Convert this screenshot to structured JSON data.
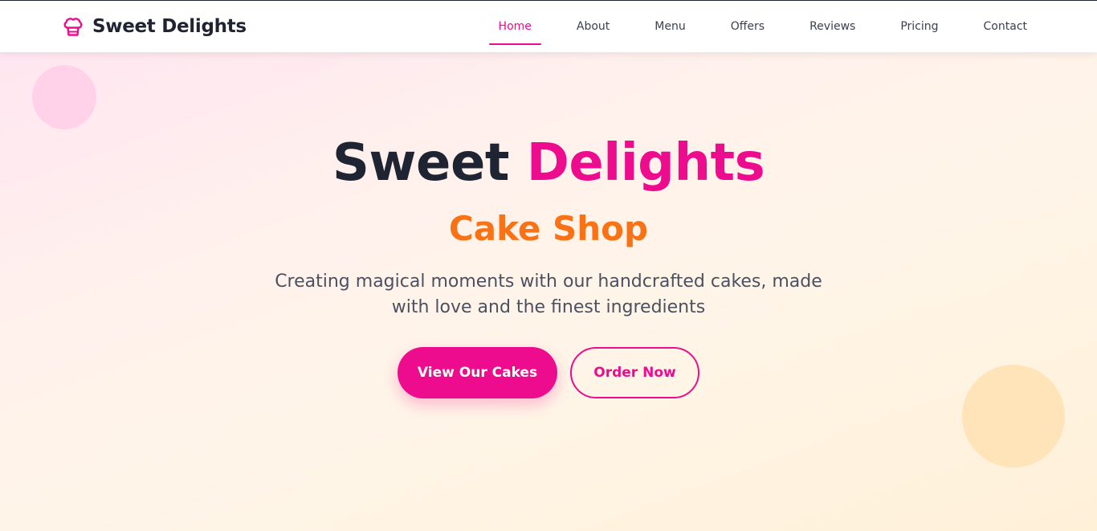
{
  "brand": {
    "name": "Sweet Delights",
    "icon": "chef-hat-icon"
  },
  "nav": {
    "items": [
      {
        "label": "Home",
        "active": true
      },
      {
        "label": "About",
        "active": false
      },
      {
        "label": "Menu",
        "active": false
      },
      {
        "label": "Offers",
        "active": false
      },
      {
        "label": "Reviews",
        "active": false
      },
      {
        "label": "Pricing",
        "active": false
      },
      {
        "label": "Contact",
        "active": false
      }
    ]
  },
  "hero": {
    "title_main": "Sweet",
    "title_accent": "Delights",
    "subtitle": "Cake Shop",
    "description": "Creating magical moments with our handcrafted cakes, made with love and the finest ingredients",
    "primary_button": "View Our Cakes",
    "secondary_button": "Order Now"
  },
  "colors": {
    "accent": "#ec0c8d",
    "secondary_accent": "#f97316",
    "heading": "#1f2433"
  }
}
